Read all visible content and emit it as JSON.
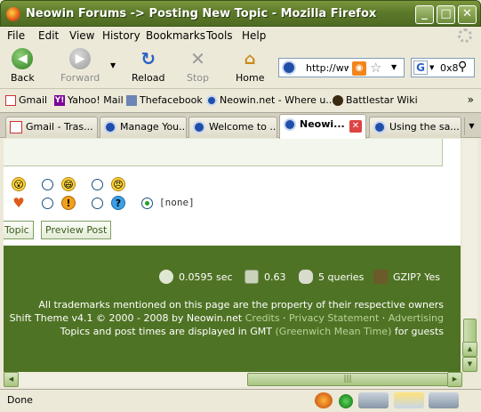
{
  "window": {
    "title": "Neowin Forums -> Posting New Topic - Mozilla Firefox"
  },
  "menu": [
    "File",
    "Edit",
    "View",
    "History",
    "Bookmarks",
    "Tools",
    "Help"
  ],
  "nav": {
    "back": "Back",
    "forward": "Forward",
    "reload": "Reload",
    "stop": "Stop",
    "home": "Home"
  },
  "url": {
    "value": "http://ww"
  },
  "search": {
    "engine": "G",
    "value": "0x8"
  },
  "bookmarks": [
    "Gmail",
    "Yahoo! Mail",
    "Thefacebook",
    "Neowin.net - Where u...",
    "Battlestar Wiki"
  ],
  "tabs": [
    {
      "label": "Gmail - Tras...",
      "icon": "gmail"
    },
    {
      "label": "Manage You...",
      "icon": "neowin"
    },
    {
      "label": "Welcome to ...",
      "icon": "neowin"
    },
    {
      "label": "Neowi...",
      "icon": "neowin",
      "active": true
    },
    {
      "label": "Using the sa...",
      "icon": "neowin"
    }
  ],
  "form": {
    "none_option": "[none]",
    "topic_button": "Topic",
    "preview_button": "Preview Post"
  },
  "stats": {
    "time": "0.0595 sec",
    "load": "0.63",
    "queries": "5 queries",
    "gzip": "GZIP? Yes"
  },
  "footer": {
    "line1": "All trademarks mentioned on this page are the property of their respective owners",
    "line2_prefix": "Shift Theme v4.1 © 2000 - 2008 by Neowin.net",
    "credits": "Credits",
    "sep": " · ",
    "privacy": "Privacy Statement",
    "advertising": "Advertising",
    "line3_prefix": "Topics and post times are displayed in GMT",
    "timezone": "(Greenwich Mean Time)",
    "line3_suffix": "for guests"
  },
  "status": {
    "text": "Done"
  },
  "colors": {
    "theme_green": "#4f7324",
    "title_green": "#5c7a2a",
    "link_green": "#b8d29a"
  }
}
